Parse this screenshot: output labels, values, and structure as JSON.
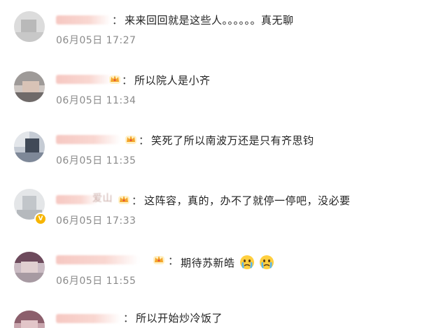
{
  "comments": [
    {
      "text": "来来回回就是这些人。。。。。。真无聊",
      "date": "06月05日",
      "time": "17:27",
      "badge": "",
      "verified": false
    },
    {
      "text": "所以院人是小齐",
      "date": "06月05日",
      "time": "11:34",
      "badge": "fan-crown-icon",
      "verified": false
    },
    {
      "text": "笑死了所以南波万还是只有齐思钧",
      "date": "06月05日",
      "time": "11:35",
      "badge": "fan-crown-icon",
      "verified": false
    },
    {
      "text": "这阵容，真的，办不了就停一停吧，没必要",
      "date": "06月05日",
      "time": "17:33",
      "badge": "fan-crown-icon",
      "verified": true,
      "name_fragment": "爱山"
    },
    {
      "text": "期待苏新皓",
      "date": "06月05日",
      "time": "11:55",
      "badge": "fan-crown-icon",
      "verified": false,
      "emojis": [
        "crying-face-emoji",
        "crying-face-emoji"
      ]
    },
    {
      "text": "所以开始炒冷饭了",
      "date": "",
      "time": "",
      "badge": "",
      "verified": false
    }
  ],
  "colon": "：",
  "colors": {
    "name_blur": "#f6c8c2",
    "time_text": "#8a8a8a",
    "comment_text": "#222222",
    "badge": "#f7b500"
  }
}
